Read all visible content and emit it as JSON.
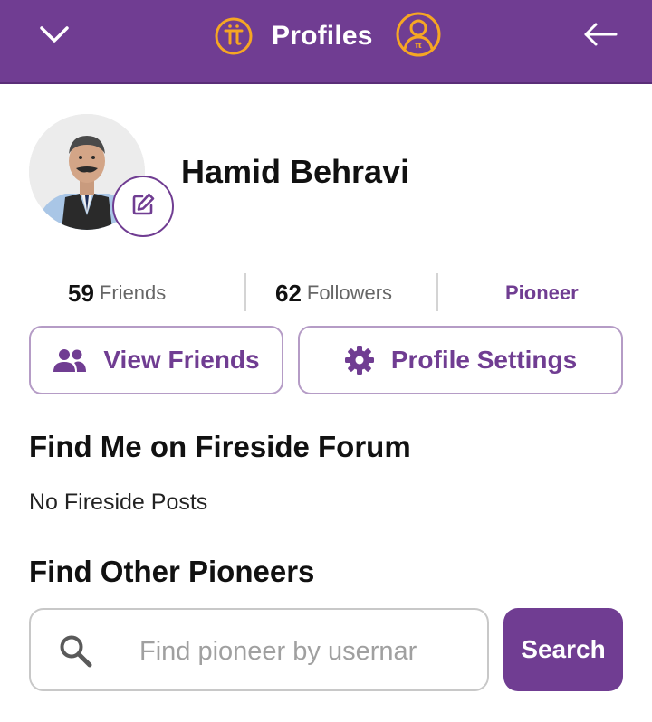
{
  "header": {
    "title": "Profiles",
    "collapse_icon": "chevron-down-icon",
    "back_icon": "arrow-left-icon",
    "logo_icon": "pi-logo-icon",
    "profile_icon": "profile-circle-icon"
  },
  "profile": {
    "name": "Hamid Behravi",
    "avatar_icon": "avatar-photo",
    "edit_icon": "pencil-edit-icon"
  },
  "stats": {
    "friends_count": "59",
    "friends_label": "Friends",
    "followers_count": "62",
    "followers_label": "Followers",
    "role": "Pioneer"
  },
  "actions": {
    "view_friends_label": "View Friends",
    "view_friends_icon": "people-icon",
    "profile_settings_label": "Profile Settings",
    "profile_settings_icon": "gear-icon"
  },
  "fireside": {
    "heading": "Find Me on Fireside Forum",
    "empty_text": "No Fireside Posts"
  },
  "find_pioneers": {
    "heading": "Find Other Pioneers",
    "placeholder": "Find pioneer by usernar",
    "value": "",
    "search_icon": "search-icon",
    "button_label": "Search"
  },
  "colors": {
    "brand_purple": "#703d92",
    "accent_orange": "#f6a623",
    "outline_purple": "#b59cc6"
  }
}
